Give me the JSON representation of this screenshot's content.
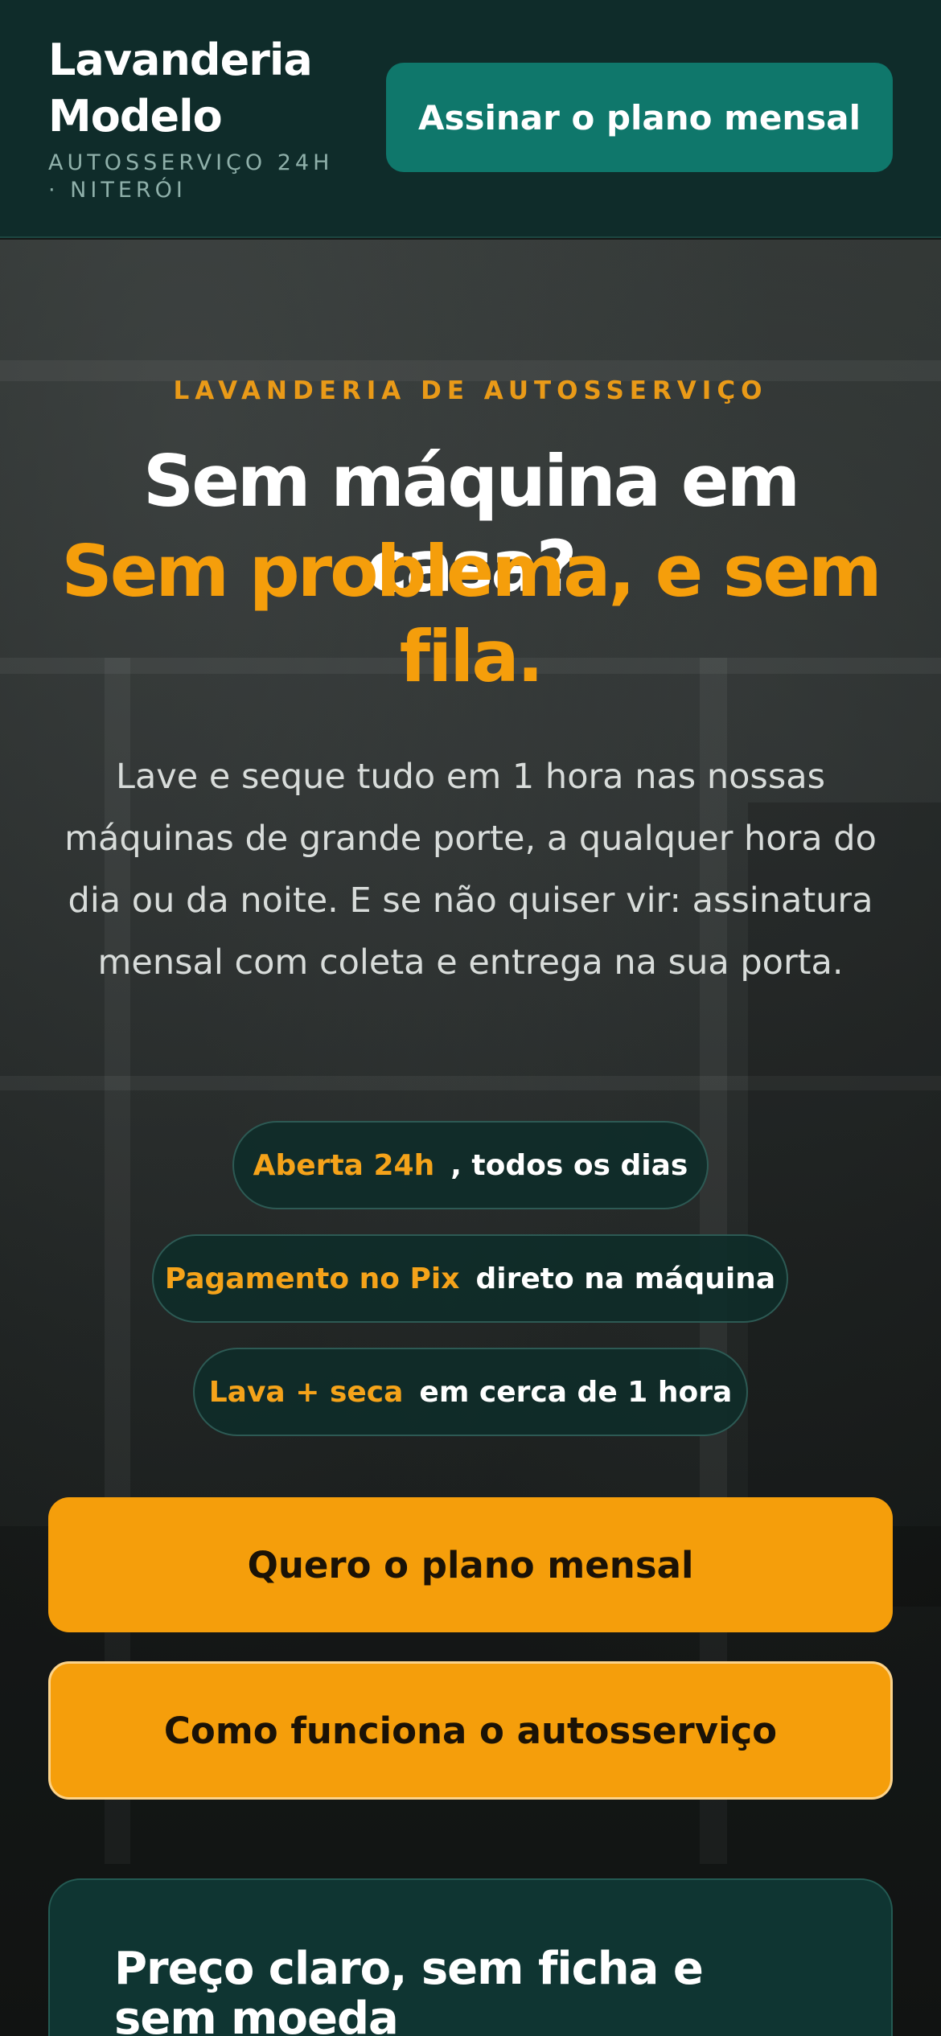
{
  "header": {
    "brand_name": "Lavanderia Modelo",
    "brand_tagline": "AUTOSSERVIÇO 24H · NITERÓI",
    "cta_label": "Assinar o plano mensal"
  },
  "hero": {
    "kicker": "LAVANDERIA DE AUTOSSERVIÇO",
    "title": "Sem máquina em casa?",
    "title_accent": "Sem problema, e sem fila.",
    "lead": "Lave e seque tudo em 1 hora nas nossas máquinas de grande porte, a qualquer hora do dia ou da noite. E se não quiser vir: assinatura mensal com coleta e entrega na sua porta.",
    "features": [
      {
        "highlight": "Aberta 24h",
        "text": ", todos os dias"
      },
      {
        "highlight": "Pagamento no Pix",
        "text": "direto na máquina"
      },
      {
        "highlight": "Lava + seca",
        "text": "em cerca de 1 hora"
      }
    ],
    "primary_cta": "Quero o plano mensal",
    "secondary_cta": "Como funciona o autosserviço"
  },
  "pricing": {
    "title": "Preço claro, sem ficha e sem moeda"
  },
  "colors": {
    "header_bg": "#0f2c2a",
    "teal_button": "#0f776b",
    "accent_orange": "#f59e0b",
    "pill_bg": "#0e2c29"
  }
}
